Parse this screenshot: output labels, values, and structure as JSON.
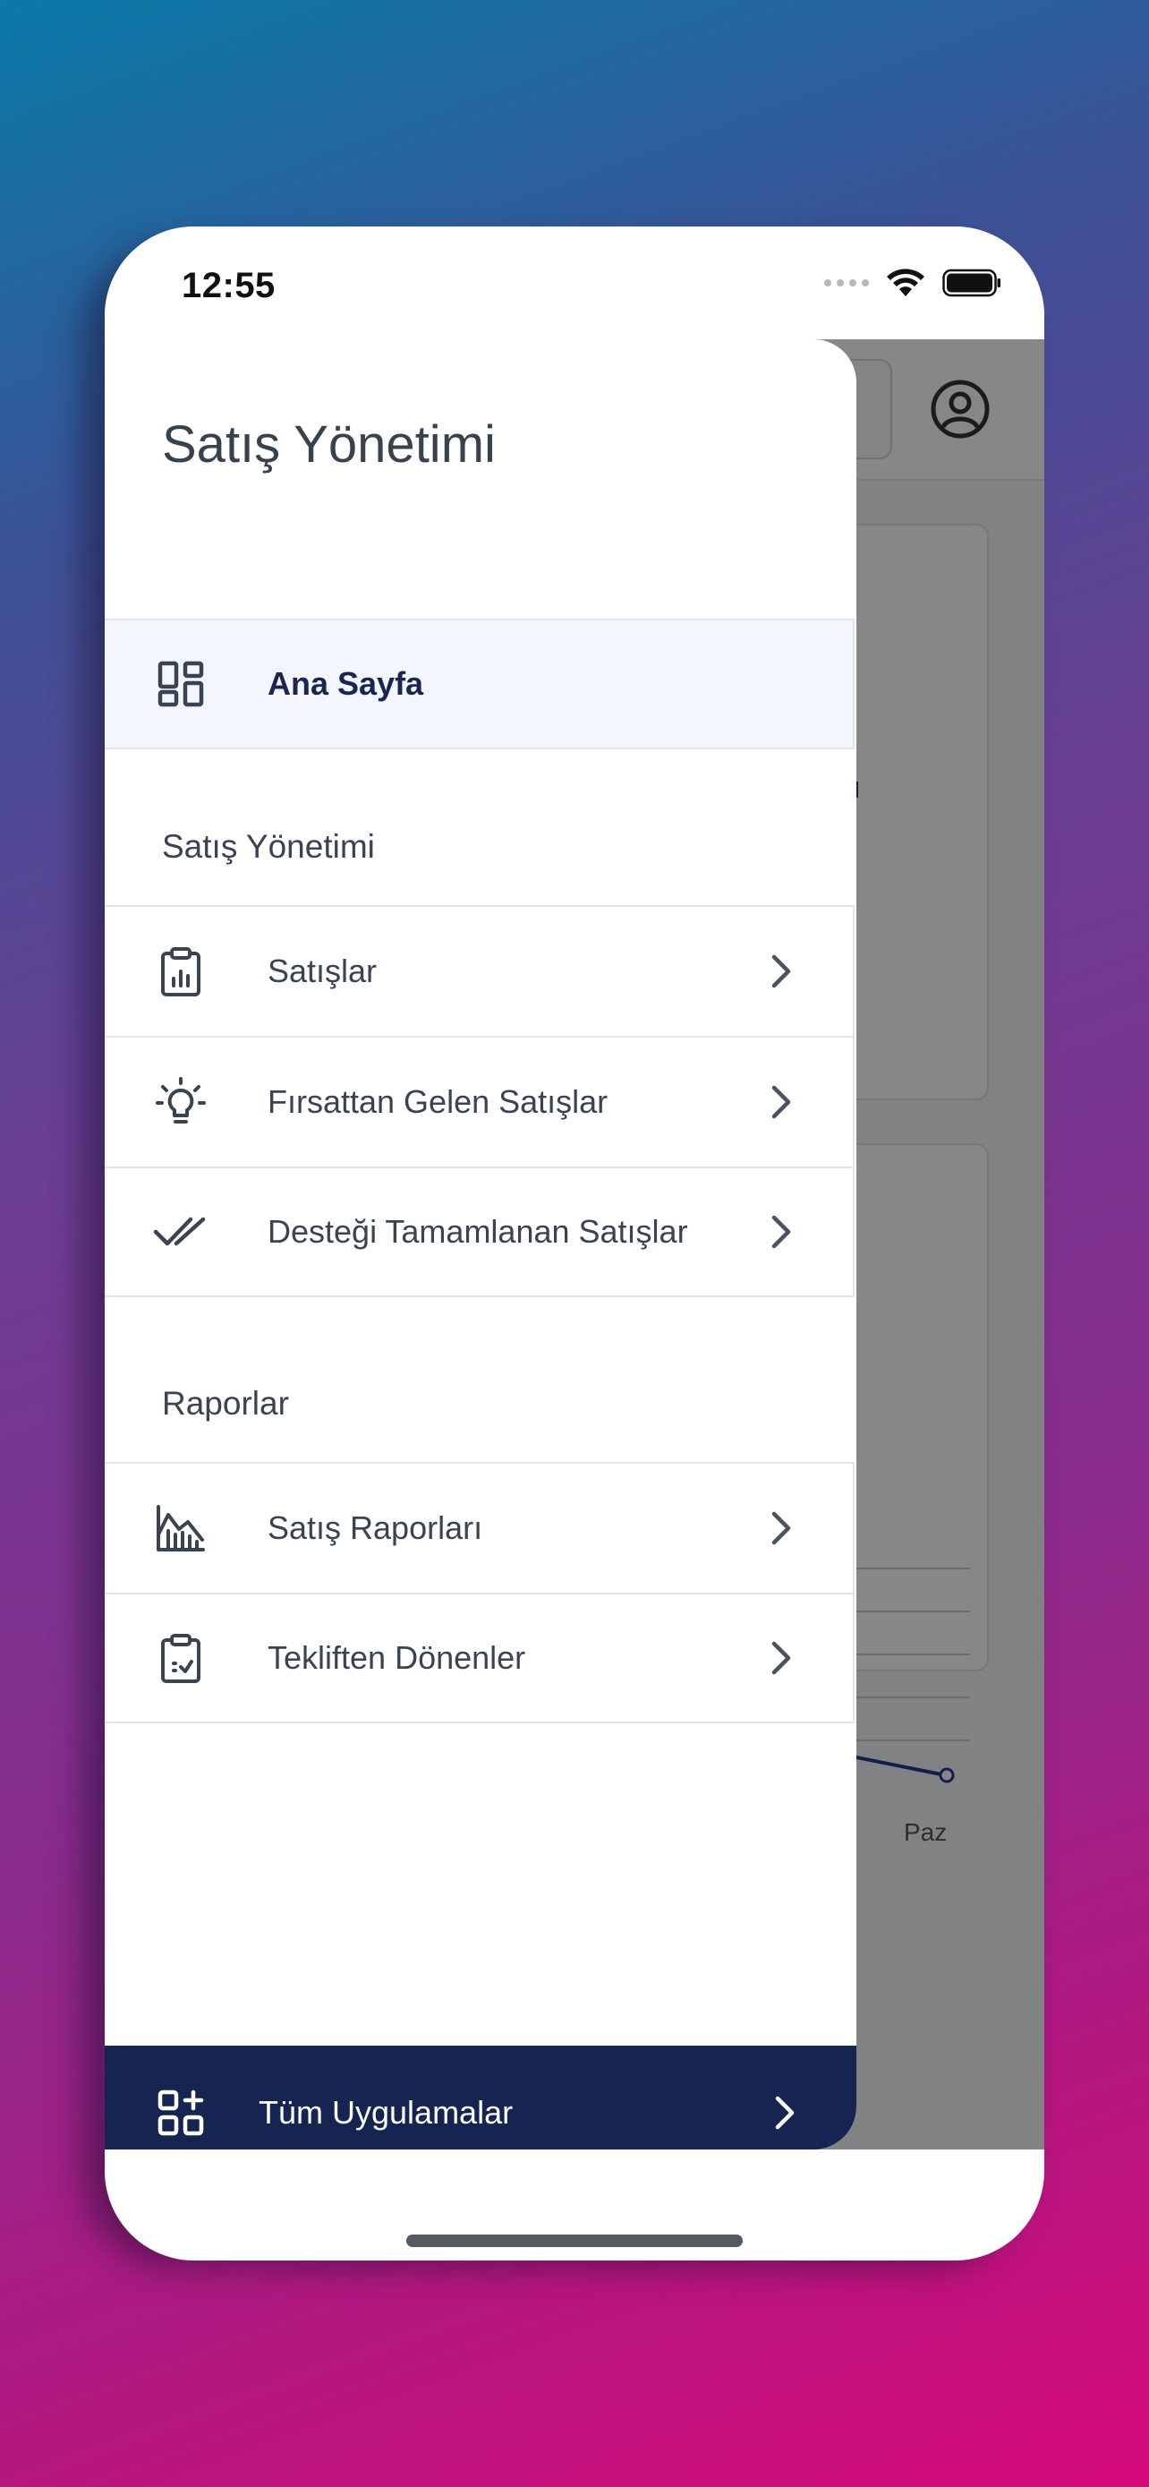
{
  "status_bar": {
    "time": "12:55"
  },
  "drawer": {
    "title": "Satış Yönetimi",
    "home_item": {
      "label": "Ana Sayfa",
      "icon": "dashboard-icon"
    },
    "sections": [
      {
        "title": "Satış Yönetimi",
        "items": [
          {
            "label": "Satışlar",
            "icon": "clipboard-chart-icon"
          },
          {
            "label": "Fırsattan Gelen Satışlar",
            "icon": "lightbulb-icon"
          },
          {
            "label": "Desteği Tamamlanan Satışlar",
            "icon": "double-check-icon"
          }
        ]
      },
      {
        "title": "Raporlar",
        "items": [
          {
            "label": "Satış Raporları",
            "icon": "chart-area-icon"
          },
          {
            "label": "Tekliften Dönenler",
            "icon": "clipboard-check-icon"
          }
        ]
      }
    ],
    "footer": {
      "label": "Tüm Uygulamalar",
      "icon": "apps-add-icon"
    }
  },
  "background": {
    "chart_x_label": "Paz"
  },
  "colors": {
    "accent": "#162452",
    "active_bg": "#f3f7fd",
    "text": "#3a4352"
  }
}
